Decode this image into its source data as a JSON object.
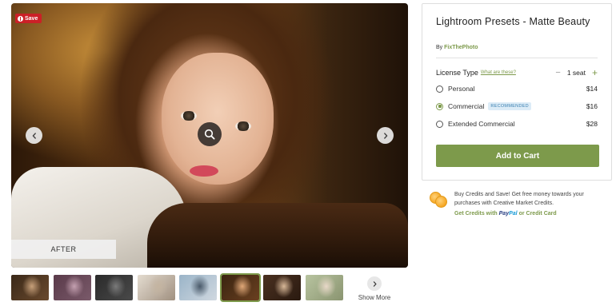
{
  "gallery": {
    "save_label": "Save",
    "after_label": "AFTER",
    "show_more_label": "Show More",
    "thumbnails": [
      {
        "colors": [
          "#3a2818",
          "#c7a07a",
          "#6a4a2e"
        ],
        "active": false
      },
      {
        "colors": [
          "#5a3a4a",
          "#c4a0b0",
          "#7a5a6a"
        ],
        "active": false
      },
      {
        "colors": [
          "#2a2a2a",
          "#7a7a7a",
          "#4a4a4a"
        ],
        "active": false
      },
      {
        "colors": [
          "#e4dcd0",
          "#c4b4a0",
          "#a09080"
        ],
        "active": false
      },
      {
        "colors": [
          "#9ab4c8",
          "#4a5a6a",
          "#d0d8e0"
        ],
        "active": false
      },
      {
        "colors": [
          "#3a2410",
          "#e0a878",
          "#6a4020"
        ],
        "active": true
      },
      {
        "colors": [
          "#4a3020",
          "#d8b898",
          "#2a1a10"
        ],
        "active": false
      },
      {
        "colors": [
          "#b8c4a0",
          "#e8d8c8",
          "#8a9470"
        ],
        "active": false
      }
    ]
  },
  "product": {
    "title": "Lightroom Presets - Matte Beauty",
    "by_label": "By",
    "shop_name": "FixThePhoto"
  },
  "license": {
    "type_label": "License Type",
    "whats_these": "What are these?",
    "seat_label": "1 seat",
    "options": [
      {
        "name": "Personal",
        "price": "$14",
        "badge": "",
        "selected": false
      },
      {
        "name": "Commercial",
        "price": "$16",
        "badge": "RECOMMENDED",
        "selected": true
      },
      {
        "name": "Extended Commercial",
        "price": "$28",
        "badge": "",
        "selected": false
      }
    ]
  },
  "cart": {
    "add_to_cart_label": "Add to Cart"
  },
  "credits": {
    "text": "Buy Credits and Save! Get free money towards your purchases with Creative Market Credits.",
    "link_prefix": "Get Credits with",
    "paypal_pay": "Pay",
    "paypal_pal": "Pal",
    "link_suffix": "or Credit Card"
  },
  "colors": {
    "accent": "#7d9a4b",
    "save_red": "#cb2027",
    "badge_bg": "#dcecf7",
    "badge_text": "#3a7fb0"
  },
  "icons": {
    "save": "pinterest-icon",
    "zoom": "search-icon",
    "prev": "chevron-left-icon",
    "next": "chevron-right-icon",
    "show_more": "chevron-right-icon",
    "credits": "coins-icon"
  }
}
